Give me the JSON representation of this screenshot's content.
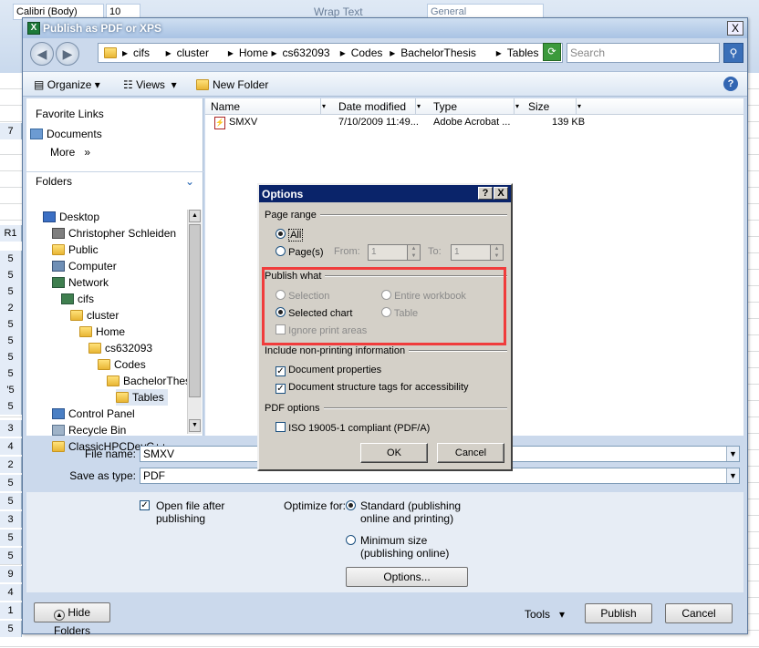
{
  "excel": {
    "font_name": "Calibri (Body)",
    "font_size": "10",
    "wrap_text": "Wrap Text",
    "number_format": "General",
    "row_cell_values": [
      "7",
      "R1",
      "5",
      "5",
      "5",
      "2",
      "5",
      "5",
      "5",
      "5",
      "'5",
      "5",
      "3",
      "4",
      "2",
      "5",
      "5",
      "3",
      "5",
      "5",
      "9",
      "4",
      "1",
      "5"
    ]
  },
  "dialog": {
    "title": "Publish as PDF or XPS",
    "close": "X",
    "back": "◀",
    "forward": "▶",
    "breadcrumbs": [
      "cifs",
      "cluster",
      "Home",
      "cs632093",
      "Codes",
      "BachelorThesis",
      "Tables"
    ],
    "search_placeholder": "Search",
    "toolbar": {
      "organize": "Organize",
      "views": "Views",
      "new_folder": "New Folder",
      "help": "?"
    },
    "favorite_links": {
      "heading": "Favorite Links",
      "items": [
        "Documents"
      ],
      "more": "More",
      "more_arrows": "»"
    },
    "folders": {
      "heading": "Folders",
      "tree": [
        {
          "label": "Desktop",
          "icon": "desktop-icon",
          "indent": 0
        },
        {
          "label": "Christopher Schleiden",
          "icon": "user-icon",
          "indent": 1
        },
        {
          "label": "Public",
          "icon": "folder-icon",
          "indent": 1
        },
        {
          "label": "Computer",
          "icon": "computer-icon",
          "indent": 1
        },
        {
          "label": "Network",
          "icon": "network-icon",
          "indent": 1
        },
        {
          "label": "cifs",
          "icon": "network-icon",
          "indent": 2
        },
        {
          "label": "cluster",
          "icon": "folder-icon",
          "indent": 3
        },
        {
          "label": "Home",
          "icon": "folder-icon",
          "indent": 4
        },
        {
          "label": "cs632093",
          "icon": "folder-icon",
          "indent": 5
        },
        {
          "label": "Codes",
          "icon": "folder-icon",
          "indent": 6
        },
        {
          "label": "BachelorThesis",
          "icon": "folder-icon",
          "indent": 7
        },
        {
          "label": "Tables",
          "icon": "folder-icon",
          "indent": 8
        },
        {
          "label": "Control Panel",
          "icon": "control-panel-icon",
          "indent": 1
        },
        {
          "label": "Recycle Bin",
          "icon": "recycle-bin-icon",
          "indent": 1
        },
        {
          "label": "ClassicHPCDevC++",
          "icon": "folder-icon",
          "indent": 1
        }
      ]
    },
    "file_list": {
      "columns": [
        "Name",
        "Date modified",
        "Type",
        "Size"
      ],
      "rows": [
        {
          "name": "SMXV",
          "date": "7/10/2009 11:49...",
          "type": "Adobe Acrobat ...",
          "size": "139 KB"
        }
      ]
    },
    "file_name_label": "File name:",
    "file_name_value": "SMXV",
    "save_type_label": "Save as type:",
    "save_type_value": "PDF",
    "open_after": "Open file after publishing",
    "optimize_label": "Optimize for:",
    "optimize_standard": "Standard (publishing online and printing)",
    "optimize_minimum": "Minimum size (publishing online)",
    "options_button": "Options...",
    "hide_folders": "Hide Folders",
    "tools": "Tools",
    "publish": "Publish",
    "cancel": "Cancel"
  },
  "options": {
    "title": "Options",
    "help": "?",
    "close": "X",
    "page_range": {
      "heading": "Page range",
      "all": "All",
      "pages": "Page(s)",
      "from": "From:",
      "from_value": "1",
      "to": "To:",
      "to_value": "1"
    },
    "publish_what": {
      "heading": "Publish what",
      "selection": "Selection",
      "entire_workbook": "Entire workbook",
      "selected_chart": "Selected chart",
      "table": "Table",
      "ignore_print_areas": "Ignore print areas"
    },
    "non_printing": {
      "heading": "Include non-printing information",
      "doc_props": "Document properties",
      "struct_tags": "Document structure tags for accessibility"
    },
    "pdf_options": {
      "heading": "PDF options",
      "iso": "ISO 19005-1 compliant (PDF/A)"
    },
    "ok": "OK",
    "cancel": "Cancel",
    "highlight_color": "#f03c3c"
  }
}
